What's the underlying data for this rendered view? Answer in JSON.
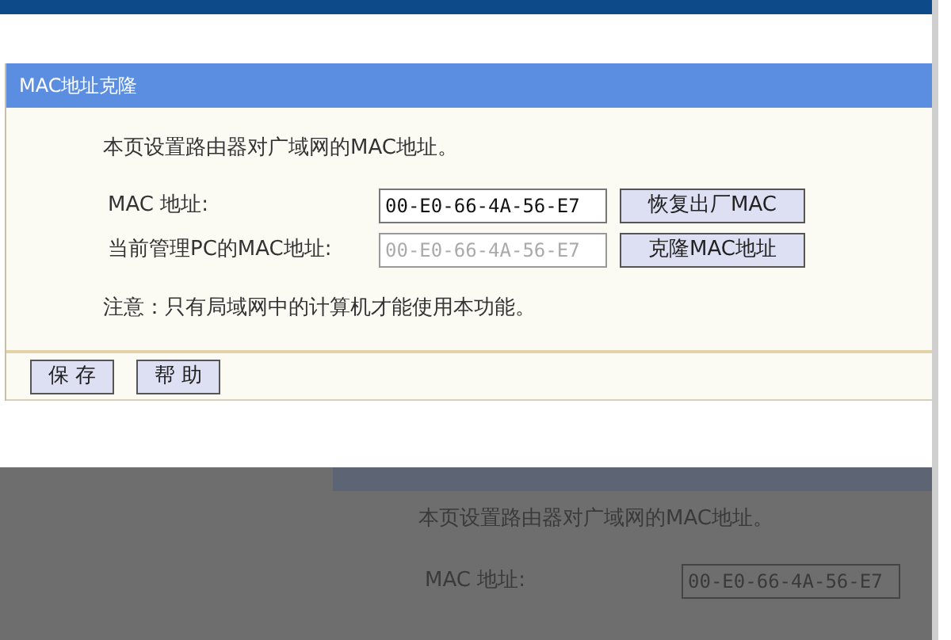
{
  "panel": {
    "title": "MAC地址克隆",
    "intro": "本页设置路由器对广域网的MAC地址。",
    "rows": [
      {
        "label": "MAC 地址:",
        "value": "00-E0-66-4A-56-E7",
        "disabled": false,
        "button": "恢复出厂MAC"
      },
      {
        "label": "当前管理PC的MAC地址:",
        "value": "00-E0-66-4A-56-E7",
        "disabled": true,
        "button": "克隆MAC地址"
      }
    ],
    "note": "注意：只有局域网中的计算机才能使用本功能。",
    "buttons": [
      "保 存",
      "帮 助"
    ]
  },
  "reflection": {
    "intro": "本页设置路由器对广域网的MAC地址。",
    "label": "MAC 地址:",
    "value": "00-E0-66-4A-56-E7"
  }
}
